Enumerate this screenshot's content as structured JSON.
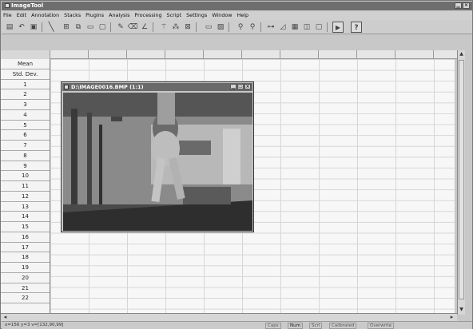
{
  "app": {
    "title": "ImageTool",
    "window_buttons": [
      "▁",
      "▭",
      "×"
    ]
  },
  "menu": [
    "File",
    "Edit",
    "Annotation",
    "Stacks",
    "Plugins",
    "Analysis",
    "Processing",
    "Script",
    "Settings",
    "Window",
    "Help"
  ],
  "toolbar": {
    "icons": [
      "open-icon",
      "undo-icon",
      "print-icon",
      "line-tool-icon",
      "rect-select-icon",
      "copy-icon",
      "paste-icon",
      "pencil-icon",
      "erase-icon",
      "angle-icon",
      "wand-icon",
      "spray-icon",
      "grid-icon",
      "text-icon",
      "zoom-in-icon",
      "zoom-out-icon",
      "link-icon",
      "measure-icon",
      "overlay-icon",
      "layers-icon",
      "blank-icon",
      "play-icon"
    ],
    "help_label": "?"
  },
  "sheet": {
    "row_labels": [
      "Mean",
      "Std. Dev.",
      "1",
      "2",
      "3",
      "4",
      "5",
      "6",
      "7",
      "8",
      "9",
      "10",
      "11",
      "12",
      "13",
      "14",
      "15",
      "16",
      "17",
      "18",
      "19",
      "20",
      "21",
      "22"
    ]
  },
  "image_window": {
    "title": "D:\\IMAGE0016.BMP (1:1)",
    "buttons": [
      "▁",
      "▭",
      "×"
    ]
  },
  "status": {
    "coords": "x=156 y=3 v=[132,90,99]",
    "fields": [
      "Caps",
      "Num",
      "Scrl",
      "Calibrated",
      "Overwrite"
    ]
  }
}
